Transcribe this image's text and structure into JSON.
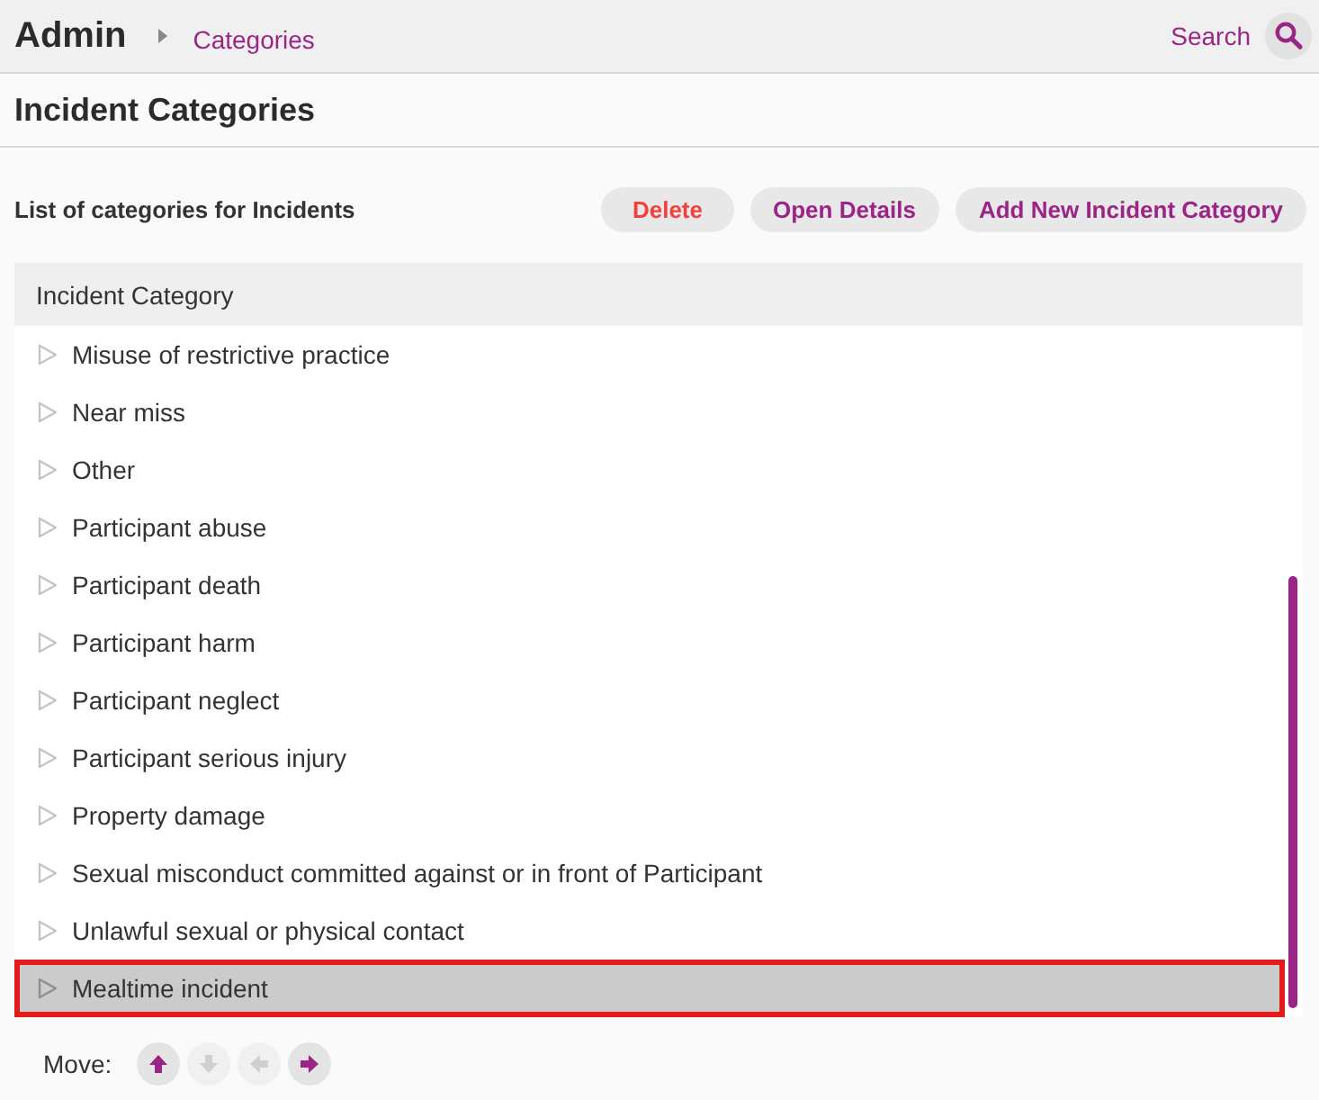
{
  "header": {
    "title": "Admin",
    "breadcrumb": "Categories",
    "search_label": "Search"
  },
  "page_title": "Incident Categories",
  "toolbar": {
    "caption": "List of categories for Incidents",
    "buttons": [
      {
        "label": "Delete",
        "kind": "danger"
      },
      {
        "label": "Open Details",
        "kind": "normal"
      },
      {
        "label": "Add New Incident Category",
        "kind": "normal"
      }
    ]
  },
  "table": {
    "columns": [
      "Incident Category"
    ],
    "rows": [
      {
        "label": "Misuse of restrictive practice",
        "selected": false
      },
      {
        "label": "Near miss",
        "selected": false
      },
      {
        "label": "Other",
        "selected": false
      },
      {
        "label": "Participant abuse",
        "selected": false
      },
      {
        "label": "Participant death",
        "selected": false
      },
      {
        "label": "Participant harm",
        "selected": false
      },
      {
        "label": "Participant neglect",
        "selected": false
      },
      {
        "label": "Participant serious injury",
        "selected": false
      },
      {
        "label": "Property damage",
        "selected": false
      },
      {
        "label": "Sexual misconduct committed against or in front of Participant",
        "selected": false
      },
      {
        "label": "Unlawful sexual or physical contact",
        "selected": false
      },
      {
        "label": "Mealtime incident",
        "selected": true
      }
    ]
  },
  "move": {
    "label": "Move:",
    "buttons": [
      {
        "kind": "up",
        "disabled": false
      },
      {
        "kind": "down",
        "disabled": true
      },
      {
        "kind": "left",
        "disabled": true
      },
      {
        "kind": "right",
        "disabled": false
      }
    ]
  }
}
